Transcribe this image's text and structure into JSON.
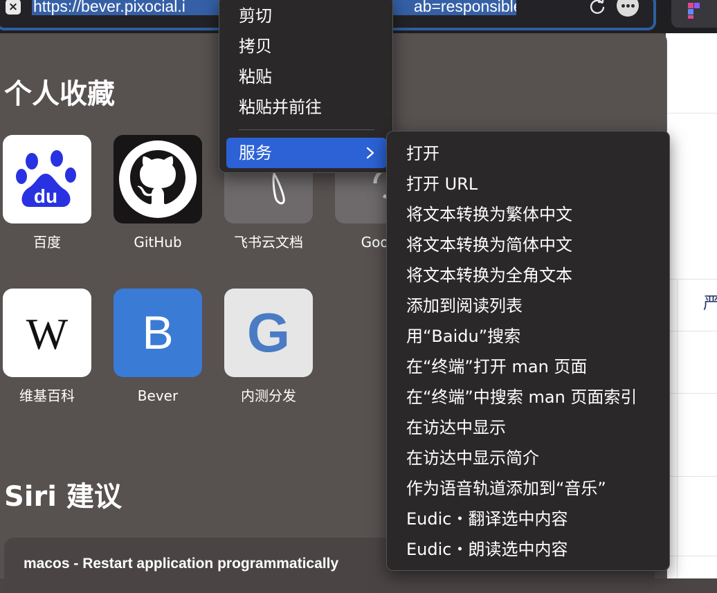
{
  "address_bar": {
    "url_visible_left": "https://bever.pixocial.i",
    "url_visible_right": "ab=responsible"
  },
  "favorites": {
    "title": "个人收藏",
    "tiles": [
      {
        "label": "百度",
        "icon": "baidu-logo-icon"
      },
      {
        "label": "GitHub",
        "icon": "github-logo-icon"
      },
      {
        "label": "飞书云文档",
        "icon": "feishu-docs-icon"
      },
      {
        "label": "Goog",
        "icon": "google-icon"
      },
      {
        "label": "维基百科",
        "icon": "wikipedia-logo-icon",
        "glyph": "W"
      },
      {
        "label": "Bever",
        "icon": "bever-letter-icon",
        "glyph": "B"
      },
      {
        "label": "内测分发",
        "icon": "google-g-icon",
        "glyph": "G"
      }
    ]
  },
  "siri": {
    "title": "Siri 建议",
    "card_title": "macos - Restart application programmatically"
  },
  "context_menu": {
    "items": [
      "剪切",
      "拷贝",
      "粘贴",
      "粘贴并前往"
    ],
    "services_label": "服务"
  },
  "services_submenu": {
    "items": [
      "打开",
      "打开 URL",
      "将文本转换为繁体中文",
      "将文本转换为简体中文",
      "将文本转换为全角文本",
      "添加到阅读列表",
      "用“Baidu”搜索",
      "在“终端”打开 man 页面",
      "在“终端”中搜索 man 页面索引",
      "在访达中显示",
      "在访达中显示简介",
      "作为语音轨道添加到“音乐”",
      "Eudic・翻译选中内容",
      "Eudic・朗读选中内容"
    ]
  },
  "right_page": {
    "glyph": "严"
  },
  "colors": {
    "accent": "#2c62d6",
    "url_selection": "#3560a6",
    "menu_bg": "#2b2829",
    "panel_bg": "#575150",
    "bever_blue": "#3a7bd5",
    "baidu_blue": "#2932e1"
  }
}
